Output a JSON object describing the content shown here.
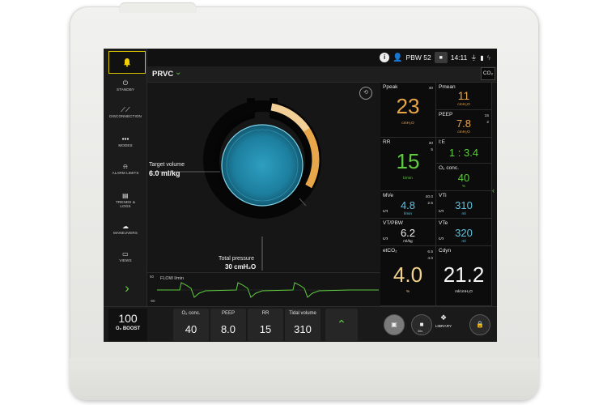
{
  "top_bar": {
    "patient_label": "PBW 52",
    "time": "14:11"
  },
  "nav": {
    "alarm": {
      "icon": "bell-icon"
    },
    "items": [
      {
        "label": "STANDBY",
        "icon": "power-icon"
      },
      {
        "label": "DISCONNECTION",
        "icon": "disconnection-icon"
      },
      {
        "label": "MODES",
        "icon": "grid-icon"
      },
      {
        "label": "ALARM LIMITS",
        "icon": "bell-limits-icon"
      },
      {
        "label": "TRENDS & LOGS",
        "icon": "trends-icon"
      },
      {
        "label": "MANEUVERS",
        "icon": "lungs-icon"
      },
      {
        "label": "VIEWS",
        "icon": "monitor-icon"
      }
    ],
    "next_icon": "chevron-right-icon"
  },
  "mode": {
    "name": "PRVC",
    "co2_label": "CO₂"
  },
  "visualization": {
    "target_volume_label": "Target volume",
    "target_volume_value": "6.0 ml/kg",
    "total_pressure_label": "Total pressure",
    "total_pressure_value": "30 cmH₂O",
    "pressure_fraction": 0.55
  },
  "waveform": {
    "label": "FLOW l/min",
    "tick_top": "50",
    "tick_bottom": "-50"
  },
  "parameters": {
    "ppeak": {
      "name": "Ppeak",
      "limit": "40",
      "value": "23",
      "unit": "cmH₂O"
    },
    "pmean": {
      "name": "Pmean",
      "value": "11",
      "unit": "cmH₂O"
    },
    "peep": {
      "name": "PEEP",
      "limit_high": "15",
      "limit_low": "2",
      "value": "7.8",
      "unit": "cmH₂O"
    },
    "rr": {
      "name": "RR",
      "limit_high": "30",
      "limit_low": "5",
      "value": "15",
      "unit": "b/min"
    },
    "ie": {
      "name": "I:E",
      "value": "1 : 3.4"
    },
    "o2": {
      "name": "O₂ conc.",
      "value": "40",
      "unit": "%"
    },
    "mve": {
      "name": "MVe",
      "limit_high": "40.0",
      "limit_low": "2.5",
      "value": "4.8",
      "unit": "l/min"
    },
    "vti": {
      "name": "VTi",
      "value": "310",
      "unit": "ml"
    },
    "vt_pbw": {
      "name": "VT/PBW",
      "value": "6.2",
      "unit": "ml/kg"
    },
    "vte": {
      "name": "VTe",
      "value": "320",
      "unit": "ml"
    },
    "etco2": {
      "name": "etCO₂",
      "limit_high": "6.5",
      "limit_low": "4.0",
      "value": "4.0",
      "unit": "%"
    },
    "cdyn": {
      "name": "Cdyn",
      "value": "21.2",
      "unit": "ml/cmH₂O"
    }
  },
  "bottom": {
    "boost_value": "100",
    "boost_label": "O₂ BOOST",
    "settings": [
      {
        "label": "O₂ conc.",
        "value": "40"
      },
      {
        "label": "PEEP",
        "value": "8.0"
      },
      {
        "label": "RR",
        "value": "15"
      },
      {
        "label": "Tidal volume",
        "value": "310"
      }
    ],
    "hold_label": "30s",
    "library_label": "LIBRARY"
  },
  "colors": {
    "green_accent": "#5ecc3e",
    "pressure_orange": "#e8a64a",
    "ppeak_color": "#e8a64a",
    "alarm_frame": "#d8c400"
  }
}
